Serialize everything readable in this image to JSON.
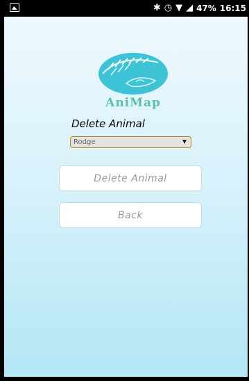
{
  "status_bar": {
    "battery": "47%",
    "time": "16:15",
    "icons": [
      "image-icon",
      "bluetooth-icon",
      "alarm-icon",
      "wifi-icon",
      "signal-icon"
    ]
  },
  "logo": {
    "text": "AniMap",
    "colors": {
      "circle": "#3ec3d6",
      "text": "#5bbfa7"
    }
  },
  "form": {
    "title": "Delete Animal",
    "animal_select": {
      "selected": "Rodge"
    },
    "delete_button": "Delete Animal",
    "back_button": "Back"
  }
}
